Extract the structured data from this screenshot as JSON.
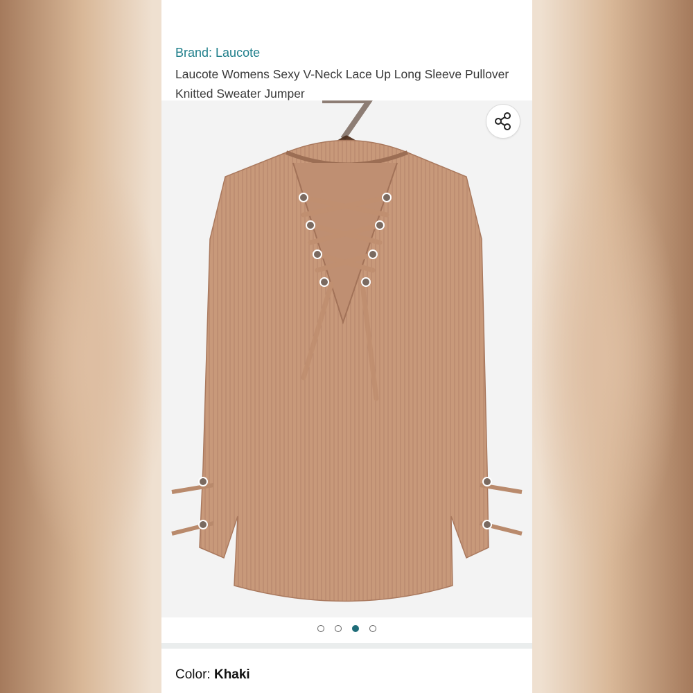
{
  "product": {
    "brand": "Brand: Laucote",
    "title": "Laucote Womens Sexy V-Neck Lace Up Long Sleeve Pullover Knitted Sweater Jumper",
    "share_icon": "share-icon",
    "carousel": {
      "total": 4,
      "active_index": 2
    },
    "color_label": "Color:",
    "color_value": "Khaki"
  },
  "colors": {
    "brand_link": "#1e7e8a",
    "active_dot": "#1e6c78",
    "sweater": "#c8997a"
  }
}
